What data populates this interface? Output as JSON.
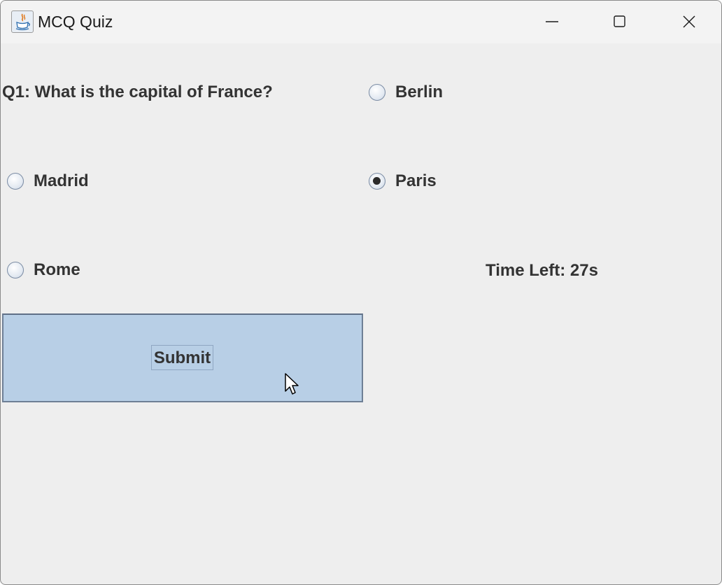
{
  "window": {
    "title": "MCQ Quiz",
    "icon": "java-cup-icon",
    "controls": [
      "minimize-icon",
      "maximize-icon",
      "close-icon"
    ]
  },
  "quiz": {
    "question": "Q1: What is the capital of France?",
    "options": [
      {
        "label": "Berlin",
        "selected": false
      },
      {
        "label": "Madrid",
        "selected": false
      },
      {
        "label": "Paris",
        "selected": true
      },
      {
        "label": "Rome",
        "selected": false
      }
    ],
    "timer": "Time Left: 27s",
    "submit_label": "Submit"
  },
  "colors": {
    "background": "#eeeeee",
    "button_fill": "#b8cfe6",
    "text": "#333333"
  }
}
